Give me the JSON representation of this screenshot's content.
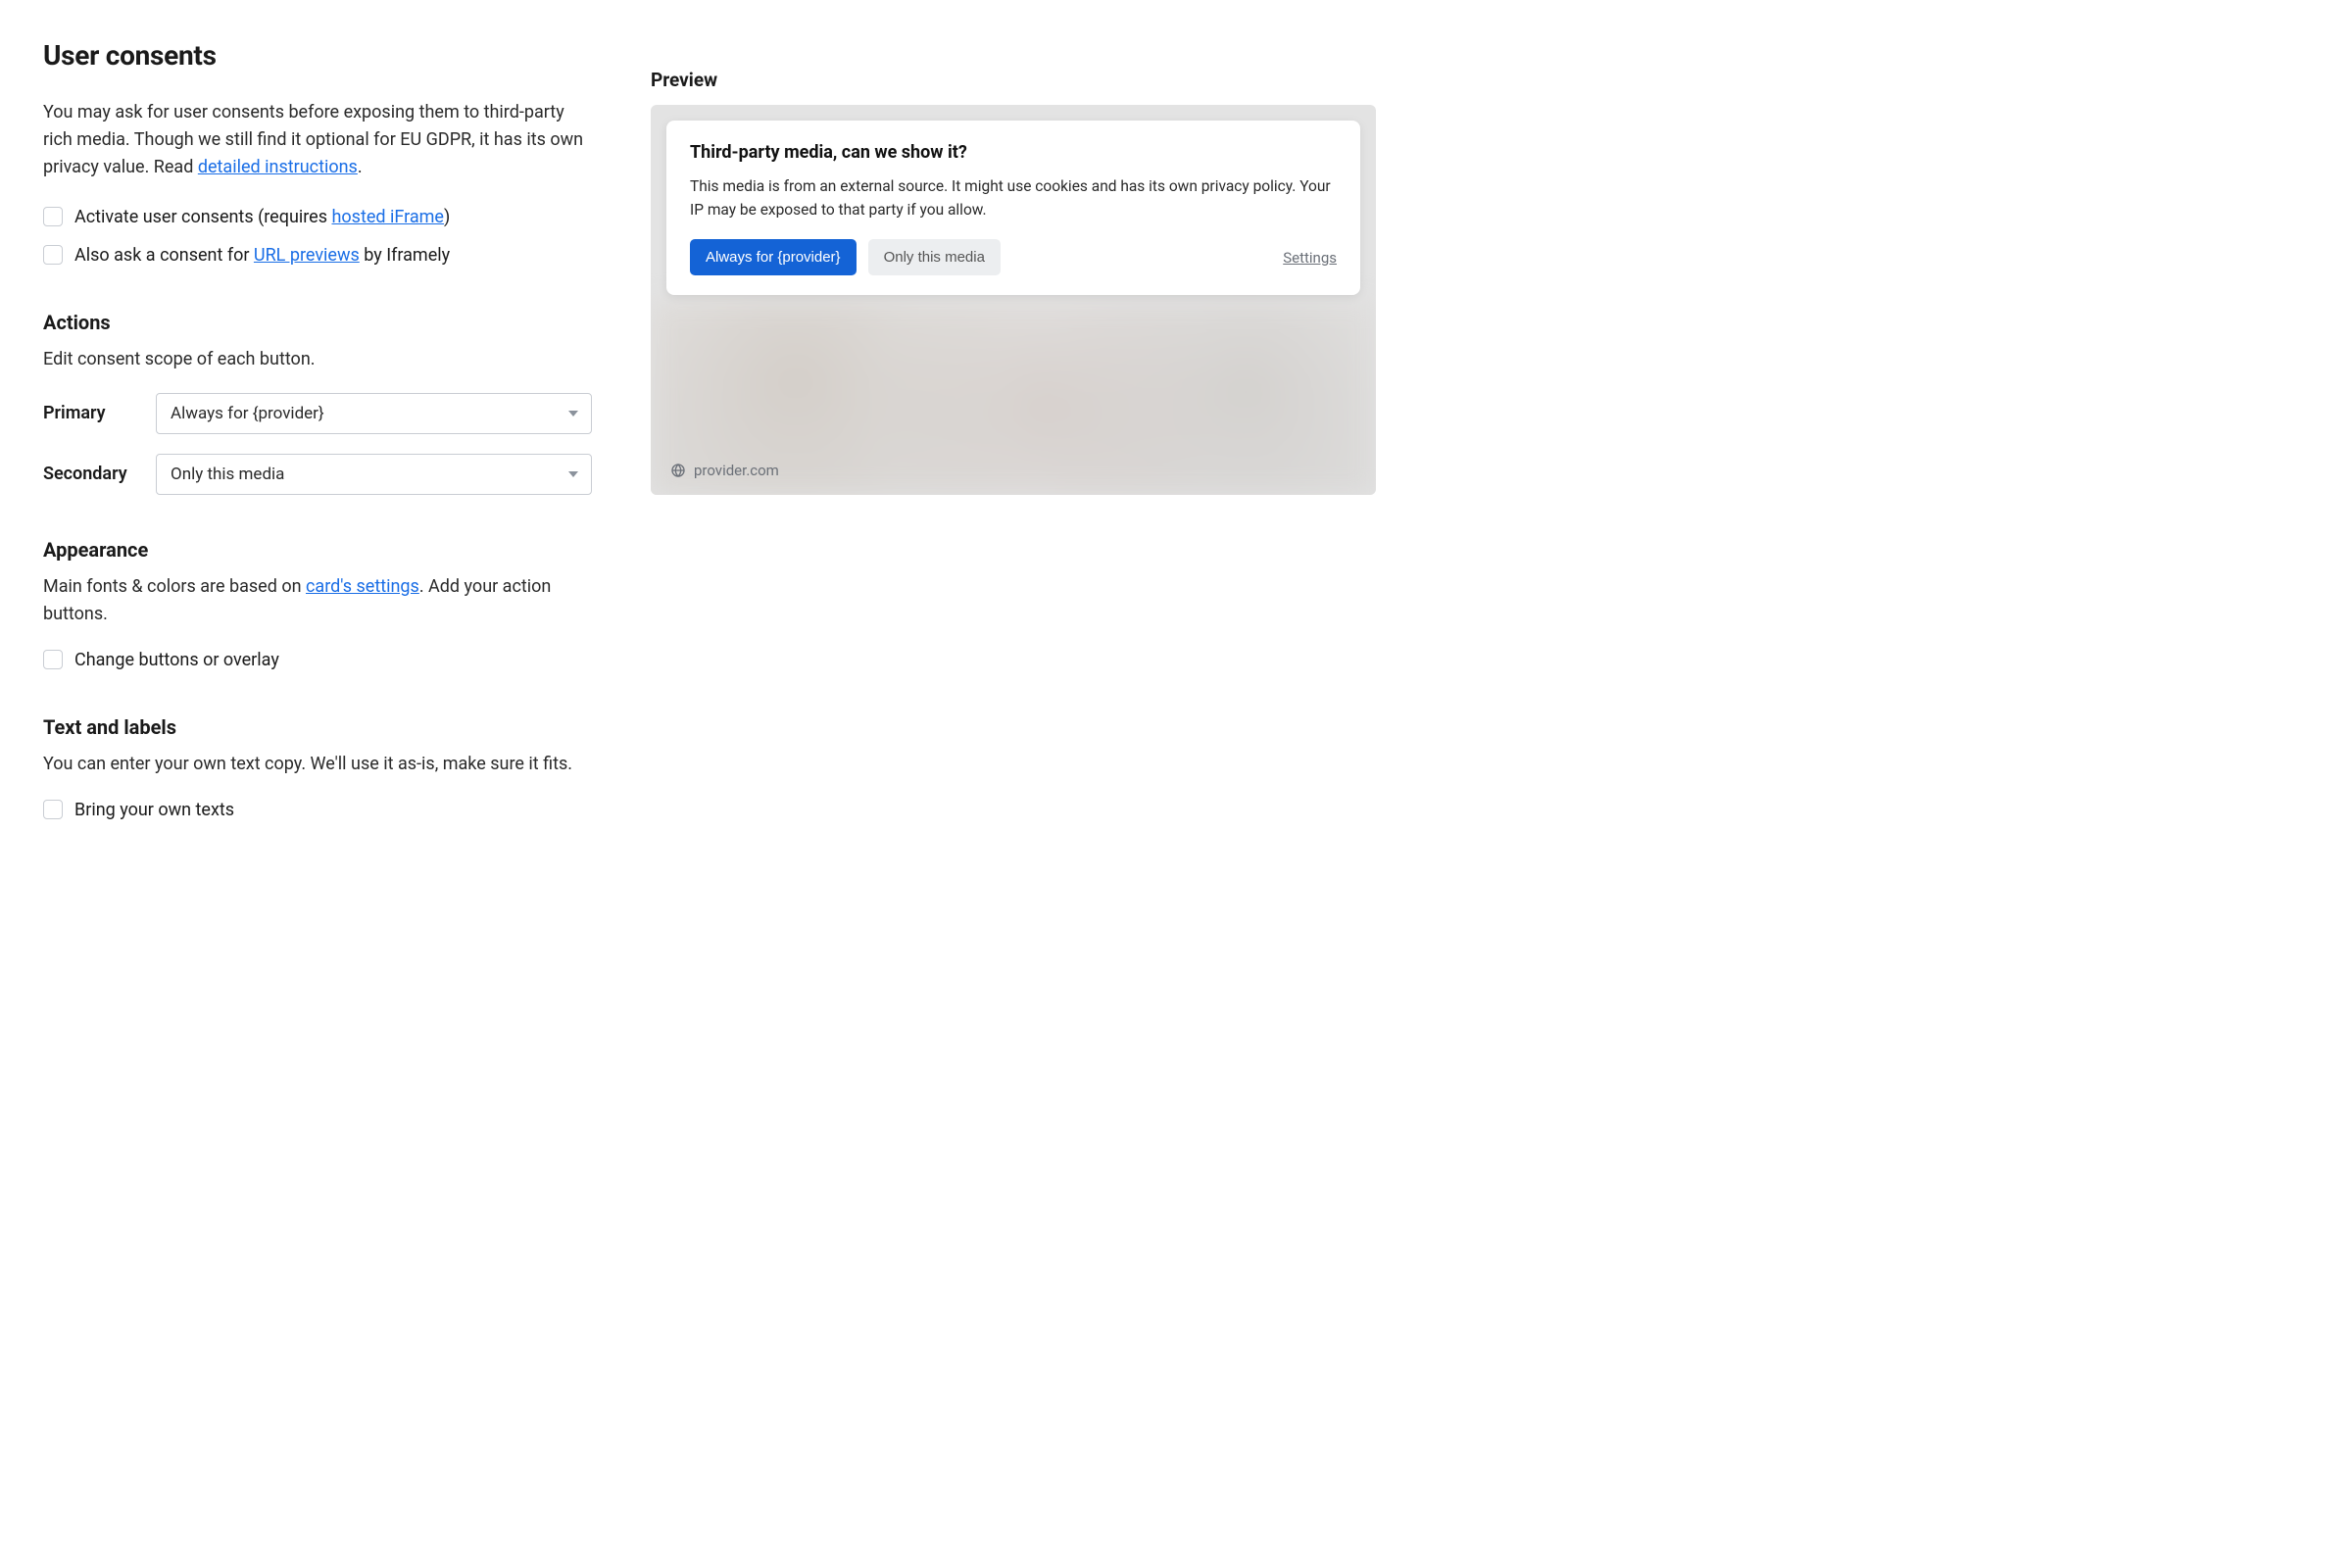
{
  "page": {
    "title": "User consents",
    "intro_pre": "You may ask for user consents before exposing them to third-party rich media. Though we still find it optional for EU GDPR, it has its own privacy value. Read ",
    "intro_link": "detailed instructions",
    "intro_post": "."
  },
  "consents": {
    "activate_pre": "Activate user consents (requires ",
    "activate_link": "hosted iFrame",
    "activate_post": ")",
    "url_previews_pre": "Also ask a consent for ",
    "url_previews_link": "URL previews",
    "url_previews_post": " by Iframely"
  },
  "actions": {
    "title": "Actions",
    "desc": "Edit consent scope of each button.",
    "primary_label": "Primary",
    "primary_value": "Always for {provider}",
    "secondary_label": "Secondary",
    "secondary_value": "Only this media"
  },
  "appearance": {
    "title": "Appearance",
    "desc_pre": "Main fonts & colors are based on ",
    "desc_link": "card's settings",
    "desc_post": ". Add your action buttons.",
    "change_label": "Change buttons or overlay"
  },
  "text_labels": {
    "title": "Text and labels",
    "desc": "You can enter your own text copy. We'll use it as-is, make sure it fits.",
    "bring_label": "Bring your own texts"
  },
  "preview": {
    "heading": "Preview",
    "card_title": "Third-party media, can we show it?",
    "card_body": "This media is from an external source. It might use cookies and has its own privacy policy. Your IP may be exposed to that party if you allow.",
    "primary_btn": "Always for {provider}",
    "secondary_btn": "Only this media",
    "settings": "Settings",
    "provider": "provider.com"
  }
}
